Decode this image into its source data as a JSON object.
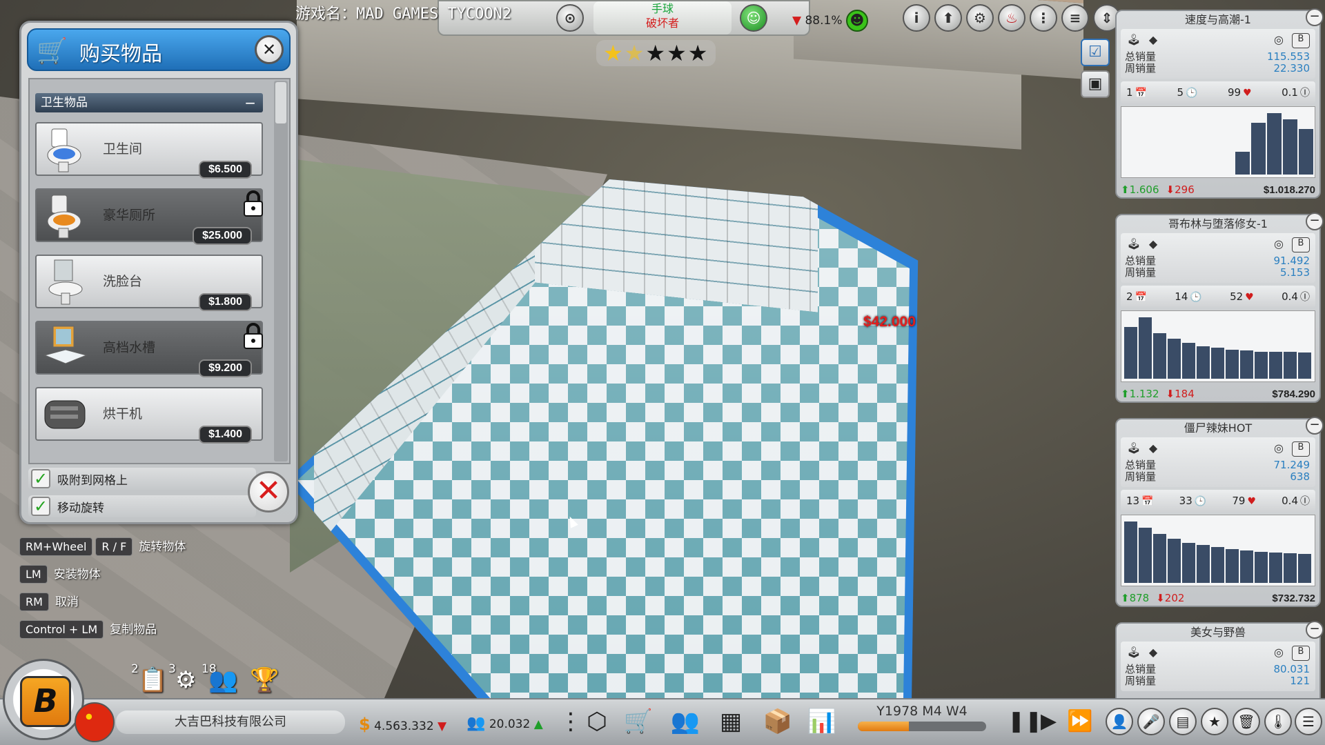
{
  "top": {
    "game_name": "游戏名：MAD GAMES TYCOON2",
    "genre_top": "手球",
    "genre_bottom": "破坏者",
    "rating_pct": "88.1%",
    "stars": 1.5
  },
  "buy_panel": {
    "title": "购买物品",
    "category": "卫生物品",
    "items": [
      {
        "name": "卫生间",
        "price": "$6.500",
        "locked": false
      },
      {
        "name": "豪华厕所",
        "price": "$25.000",
        "locked": true
      },
      {
        "name": "洗脸台",
        "price": "$1.800",
        "locked": false
      },
      {
        "name": "高档水槽",
        "price": "$9.200",
        "locked": true
      },
      {
        "name": "烘干机",
        "price": "$1.400",
        "locked": false
      }
    ],
    "options": [
      {
        "label": "吸附到网格上",
        "checked": true
      },
      {
        "label": "移动旋转",
        "checked": true
      }
    ]
  },
  "hints": [
    {
      "keys": [
        "RM+Wheel",
        "R / F"
      ],
      "desc": "旋转物体"
    },
    {
      "keys": [
        "LM"
      ],
      "desc": "安装物体"
    },
    {
      "keys": [
        "RM"
      ],
      "desc": "取消"
    },
    {
      "keys": [
        "Control + LM"
      ],
      "desc": "复制物品"
    }
  ],
  "room_price": "$42.000",
  "cards": [
    {
      "title": "速度与高潮-1",
      "sales_label_1": "总销量",
      "sales_label_2": "周销量",
      "total_sales": "115.553",
      "weekly_sales": "22.330",
      "stat1": "1",
      "stat2": "5",
      "stat3": "99",
      "stat4": "0.1",
      "up": "1.606",
      "down": "296",
      "revenue": "$1.018.270",
      "bars": [
        0,
        0,
        0,
        0,
        0,
        0,
        0,
        0.35,
        0.8,
        0.95,
        0.85,
        0.7
      ]
    },
    {
      "title": "哥布林与堕落修女-1",
      "sales_label_1": "总销量",
      "sales_label_2": "周销量",
      "total_sales": "91.492",
      "weekly_sales": "5.153",
      "stat1": "2",
      "stat2": "14",
      "stat3": "52",
      "stat4": "0.4",
      "up": "1.132",
      "down": "184",
      "revenue": "$784.290",
      "bars": [
        0.8,
        0.95,
        0.7,
        0.62,
        0.55,
        0.5,
        0.48,
        0.45,
        0.44,
        0.42,
        0.42,
        0.41,
        0.4
      ]
    },
    {
      "title": "僵尸辣妹HOT",
      "sales_label_1": "总销量",
      "sales_label_2": "周销量",
      "total_sales": "71.249",
      "weekly_sales": "638",
      "stat1": "13",
      "stat2": "33",
      "stat3": "79",
      "stat4": "0.4",
      "up": "878",
      "down": "202",
      "revenue": "$732.732",
      "bars": [
        0.95,
        0.85,
        0.75,
        0.68,
        0.62,
        0.58,
        0.55,
        0.52,
        0.5,
        0.48,
        0.47,
        0.46,
        0.45
      ]
    },
    {
      "title": "美女与野兽",
      "sales_label_1": "总销量",
      "sales_label_2": "周销量",
      "total_sales": "80.031",
      "weekly_sales": "121"
    }
  ],
  "bottom": {
    "company": "大吉巴科技有限公司",
    "money": "4.563.332",
    "fans": "20.032",
    "date": "Y1978 M4 W4",
    "date_progress": 0.4,
    "stat_counts": [
      "2",
      "3",
      "18"
    ]
  },
  "colors": {
    "accent_blue": "#2d82d9",
    "price_red": "#e21d1d",
    "up_green": "#1f9e2a",
    "down_red": "#d01d1d"
  }
}
